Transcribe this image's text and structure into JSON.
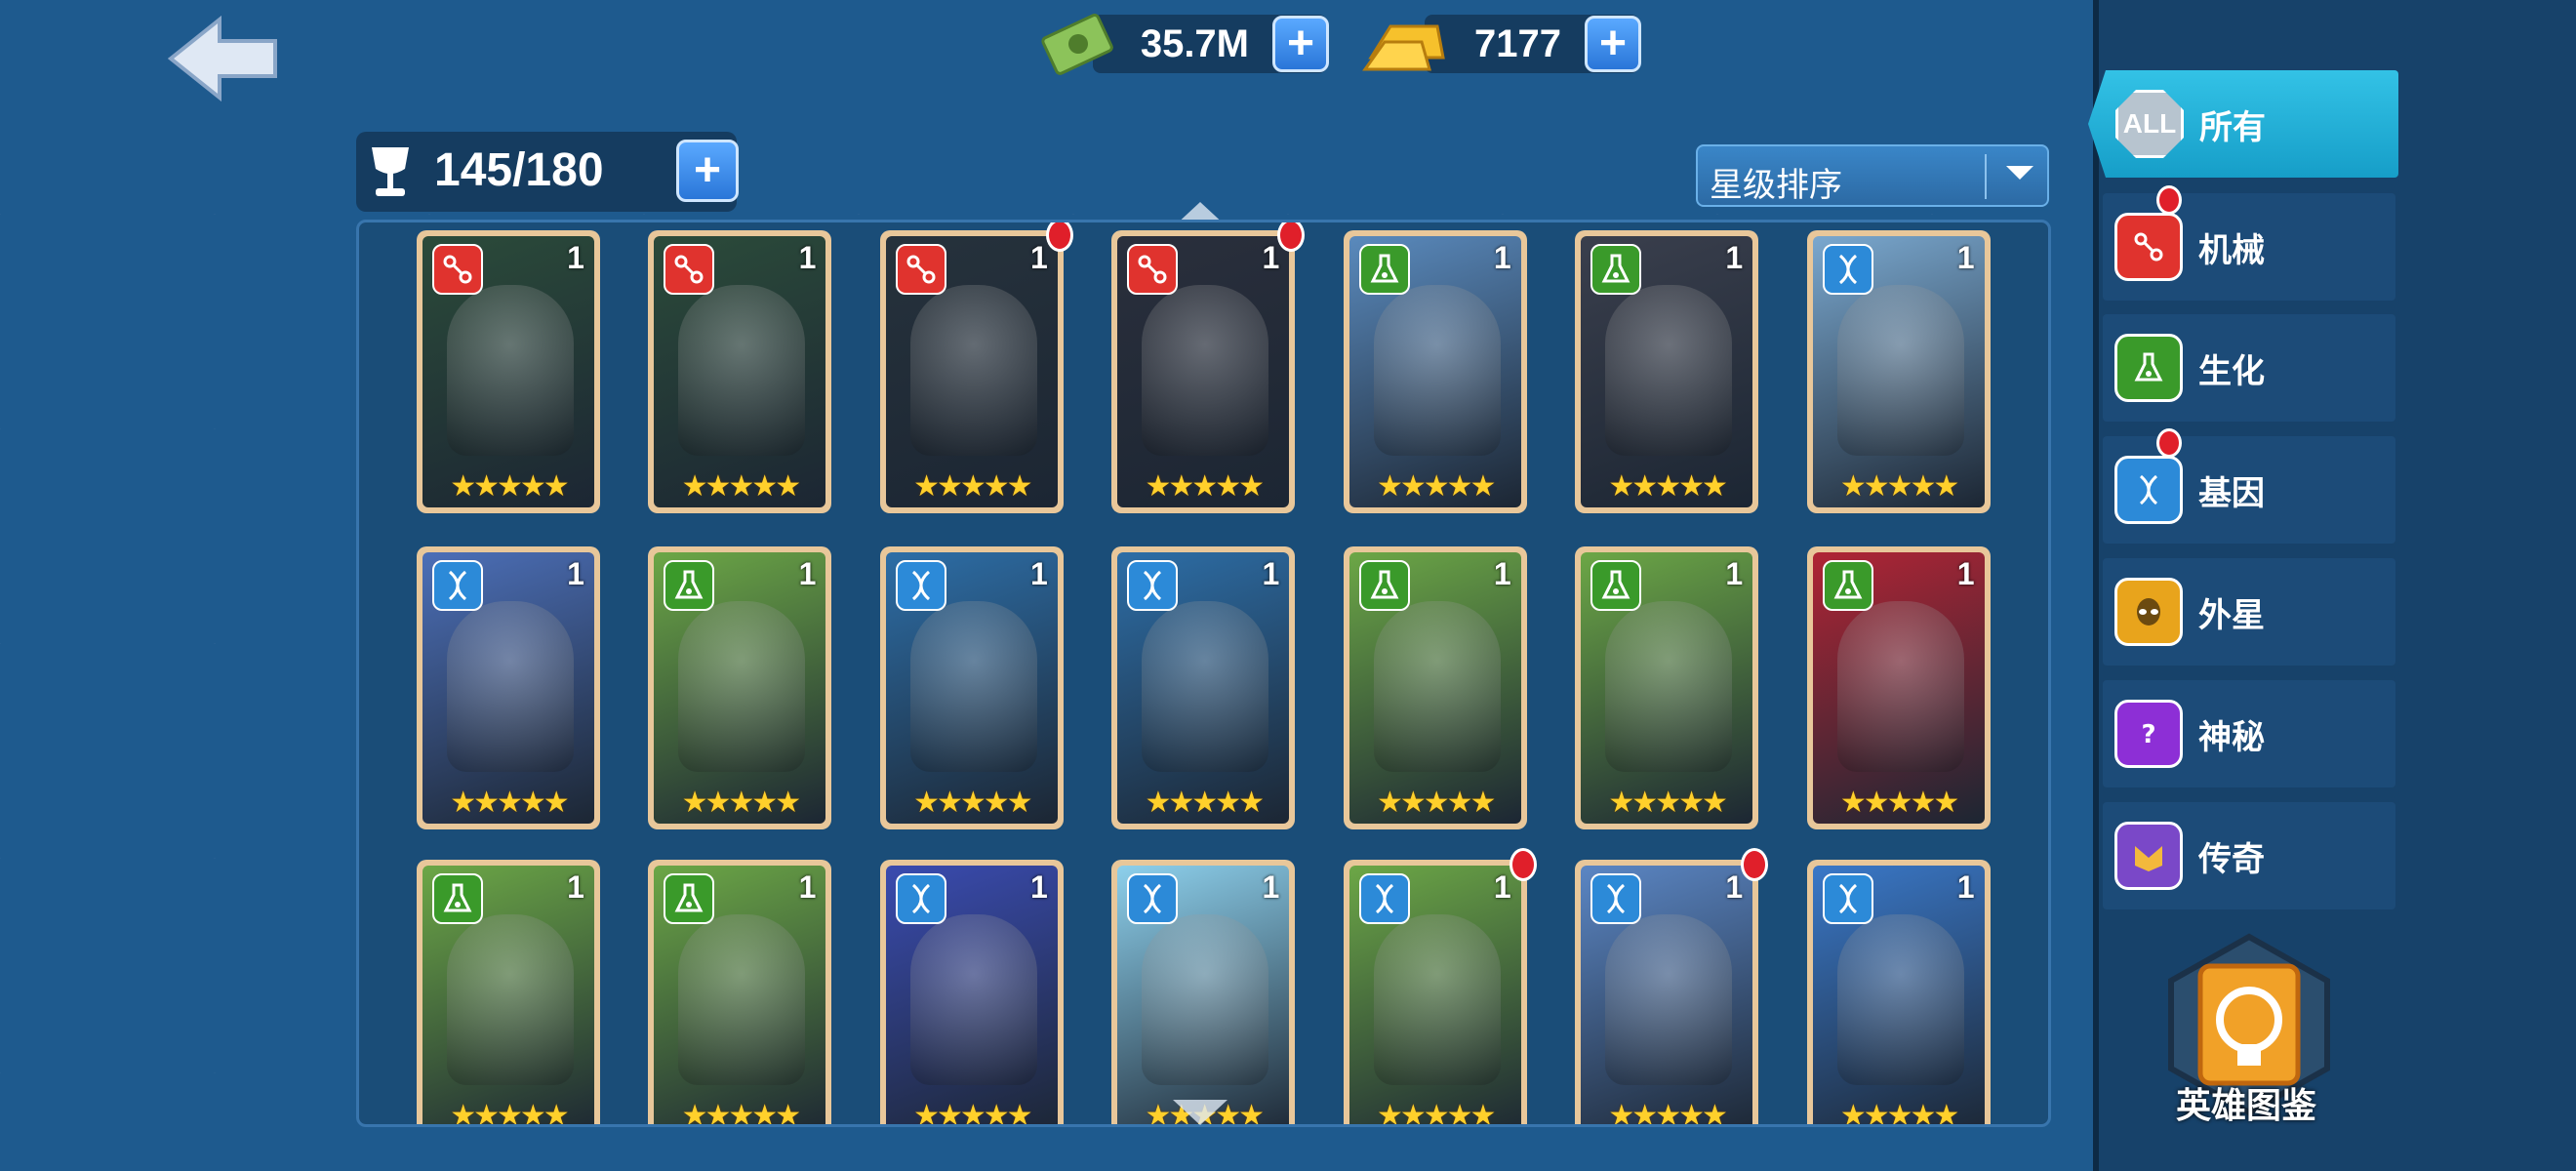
{
  "currencies": {
    "cash": {
      "value": "35.7M",
      "icon": "cash-icon"
    },
    "gold": {
      "value": "7177",
      "icon": "gold-bar-icon"
    }
  },
  "capacity": {
    "value": "145/180",
    "icon": "cup-icon"
  },
  "sort": {
    "label": "星级排序"
  },
  "categories": [
    {
      "id": "all",
      "icon_text": "ALL",
      "label": "所有",
      "active": true
    },
    {
      "id": "mech",
      "label": "机械",
      "icon": "mech-icon",
      "badge": true
    },
    {
      "id": "bio",
      "label": "生化",
      "icon": "flask-icon",
      "badge": false
    },
    {
      "id": "gene",
      "label": "基因",
      "icon": "dna-icon",
      "badge": true
    },
    {
      "id": "alien",
      "label": "外星",
      "icon": "alien-icon",
      "badge": false
    },
    {
      "id": "mystic",
      "label": "神秘",
      "icon": "mystic-icon",
      "badge": false
    },
    {
      "id": "legend",
      "label": "传奇",
      "icon": "legend-icon",
      "badge": false
    }
  ],
  "codex_label": "英雄图鉴",
  "cards": [
    {
      "type": "mech",
      "level": "1",
      "stars": "★★★★★",
      "alert": false,
      "color": "#2b4b3a"
    },
    {
      "type": "mech",
      "level": "1",
      "stars": "★★★★★",
      "alert": false,
      "color": "#2b4b3a"
    },
    {
      "type": "mech",
      "level": "1",
      "stars": "★★★★★",
      "alert": true,
      "color": "#26323c"
    },
    {
      "type": "mech",
      "level": "1",
      "stars": "★★★★★",
      "alert": true,
      "color": "#2a2f3c"
    },
    {
      "type": "bio",
      "level": "1",
      "stars": "★★★★★",
      "alert": false,
      "color": "#5a8abd"
    },
    {
      "type": "bio",
      "level": "1",
      "stars": "★★★★★",
      "alert": false,
      "color": "#3a3f4d"
    },
    {
      "type": "gene",
      "level": "1",
      "stars": "★★★★★",
      "alert": false,
      "color": "#7aa8cf"
    },
    {
      "type": "gene",
      "level": "1",
      "stars": "★★★★★",
      "alert": false,
      "color": "#4c6fb8"
    },
    {
      "type": "bio",
      "level": "1",
      "stars": "★★★★★",
      "alert": false,
      "color": "#6ca746"
    },
    {
      "type": "gene",
      "level": "1",
      "stars": "★★★★★",
      "alert": false,
      "color": "#2d6ea7"
    },
    {
      "type": "gene",
      "level": "1",
      "stars": "★★★★★",
      "alert": false,
      "color": "#2d6ea7"
    },
    {
      "type": "bio",
      "level": "1",
      "stars": "★★★★★",
      "alert": false,
      "color": "#6ca746"
    },
    {
      "type": "bio",
      "level": "1",
      "stars": "★★★★★",
      "alert": false,
      "color": "#6ca746"
    },
    {
      "type": "bio",
      "level": "1",
      "stars": "★★★★★",
      "alert": false,
      "color": "#b02535"
    },
    {
      "type": "bio",
      "level": "1",
      "stars": "★★★★★",
      "alert": false,
      "color": "#6ca746"
    },
    {
      "type": "bio",
      "level": "1",
      "stars": "★★★★★",
      "alert": false,
      "color": "#6ca746"
    },
    {
      "type": "gene",
      "level": "1",
      "stars": "★★★★★",
      "alert": false,
      "color": "#3a4bb0"
    },
    {
      "type": "gene",
      "level": "1",
      "stars": "★★★★★",
      "alert": false,
      "color": "#8dd0ec"
    },
    {
      "type": "gene",
      "level": "1",
      "stars": "★★★★★",
      "alert": true,
      "color": "#6ca746"
    },
    {
      "type": "gene",
      "level": "1",
      "stars": "★★★★★",
      "alert": true,
      "color": "#5b86c4"
    },
    {
      "type": "gene",
      "level": "1",
      "stars": "★★★★★",
      "alert": false,
      "color": "#3a78c8"
    }
  ]
}
